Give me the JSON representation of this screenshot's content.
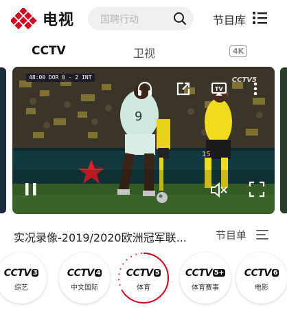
{
  "header": {
    "app_title": "电视",
    "search_placeholder": "国聘行动",
    "library_label": "节目库",
    "logo_color": "#d7001e"
  },
  "tabs": [
    {
      "label": "CCTV",
      "active": true
    },
    {
      "label": "卫视",
      "active": false
    },
    {
      "label": "4K",
      "active": false
    }
  ],
  "player": {
    "scoreboard": "48:00  DOR  0 - 2  INT",
    "channel_watermark": "CCTV5",
    "controls": [
      "headphones-icon",
      "share-icon",
      "cast-icon",
      "more-icon",
      "pause-icon",
      "mute-icon",
      "fullscreen-icon"
    ]
  },
  "program": {
    "title": "实况录像-2019/2020欧洲冠军联...",
    "list_label": "节目单"
  },
  "channels": [
    {
      "name": "CCTV",
      "num": "3",
      "sub": "综艺",
      "active": false
    },
    {
      "name": "CCTV",
      "num": "4",
      "sub": "中文国际",
      "active": false
    },
    {
      "name": "CCTV",
      "num": "5",
      "sub": "体育",
      "active": true
    },
    {
      "name": "CCTV",
      "num": "5+",
      "sub": "体育赛事",
      "active": false
    },
    {
      "name": "CCTV",
      "num": "6",
      "sub": "电影",
      "active": false
    }
  ],
  "colors": {
    "accent": "#d7001e",
    "search_bg": "#f0f0f2"
  }
}
